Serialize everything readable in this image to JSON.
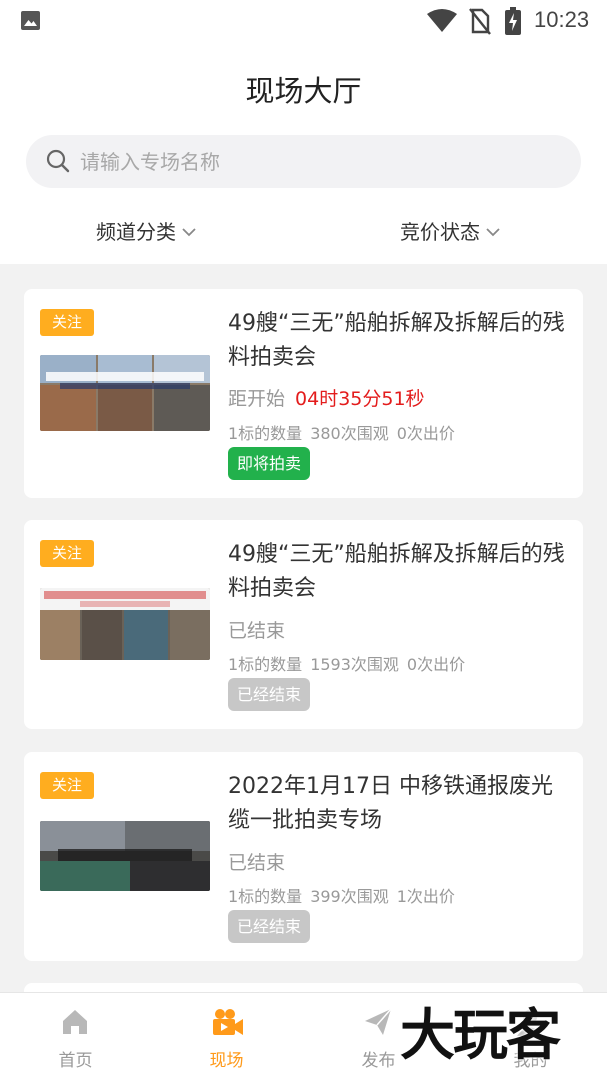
{
  "status_bar": {
    "time": "10:23"
  },
  "page_title": "现场大厅",
  "search": {
    "placeholder": "请输入专场名称"
  },
  "filters": {
    "channel": "频道分类",
    "status": "竞价状态"
  },
  "cards": [
    {
      "follow": "关注",
      "title": "49艘“三无”船舶拆解及拆解后的残料拍卖会",
      "countdown_label": "距开始",
      "countdown_time": "04时35分51秒",
      "stats": {
        "quantity": "1标的数量",
        "views": "380次围观",
        "bids": "0次出价"
      },
      "badge": "即将拍卖",
      "thumb_caption": "49艘“三无”船舶拆解及拆解后的残料拍卖"
    },
    {
      "follow": "关注",
      "title": "49艘“三无”船舶拆解及拆解后的残料拍卖会",
      "status_text": "已结束",
      "stats": {
        "quantity": "1标的数量",
        "views": "1593次围观",
        "bids": "0次出价"
      },
      "badge": "已经结束",
      "thumb_caption": "49艘“三无”船舶拆解及拆解后的残料拍卖",
      "thumb_subcaption": "拍卖时间：2022年2月21日下午3时"
    },
    {
      "follow": "关注",
      "title": "2022年1月17日 中移铁通报废光缆一批拍卖专场",
      "status_text": "已结束",
      "stats": {
        "quantity": "1标的数量",
        "views": "399次围观",
        "bids": "1次出价"
      },
      "badge": "已经结束",
      "thumb_caption": "中移铁通报废光缆一批拍卖专场"
    }
  ],
  "tabs": [
    {
      "label": "首页",
      "icon": "home-icon"
    },
    {
      "label": "现场",
      "icon": "video-camera-icon"
    },
    {
      "label": "发布",
      "icon": "paper-plane-icon"
    },
    {
      "label": "我的",
      "icon": "user-icon"
    }
  ],
  "watermark": "大玩客",
  "colors": {
    "accent": "#ff9a1a",
    "follow_badge": "#ffad1f",
    "countdown": "#e31c1c",
    "upcoming": "#22b14c",
    "ended": "#c7c7c7"
  }
}
